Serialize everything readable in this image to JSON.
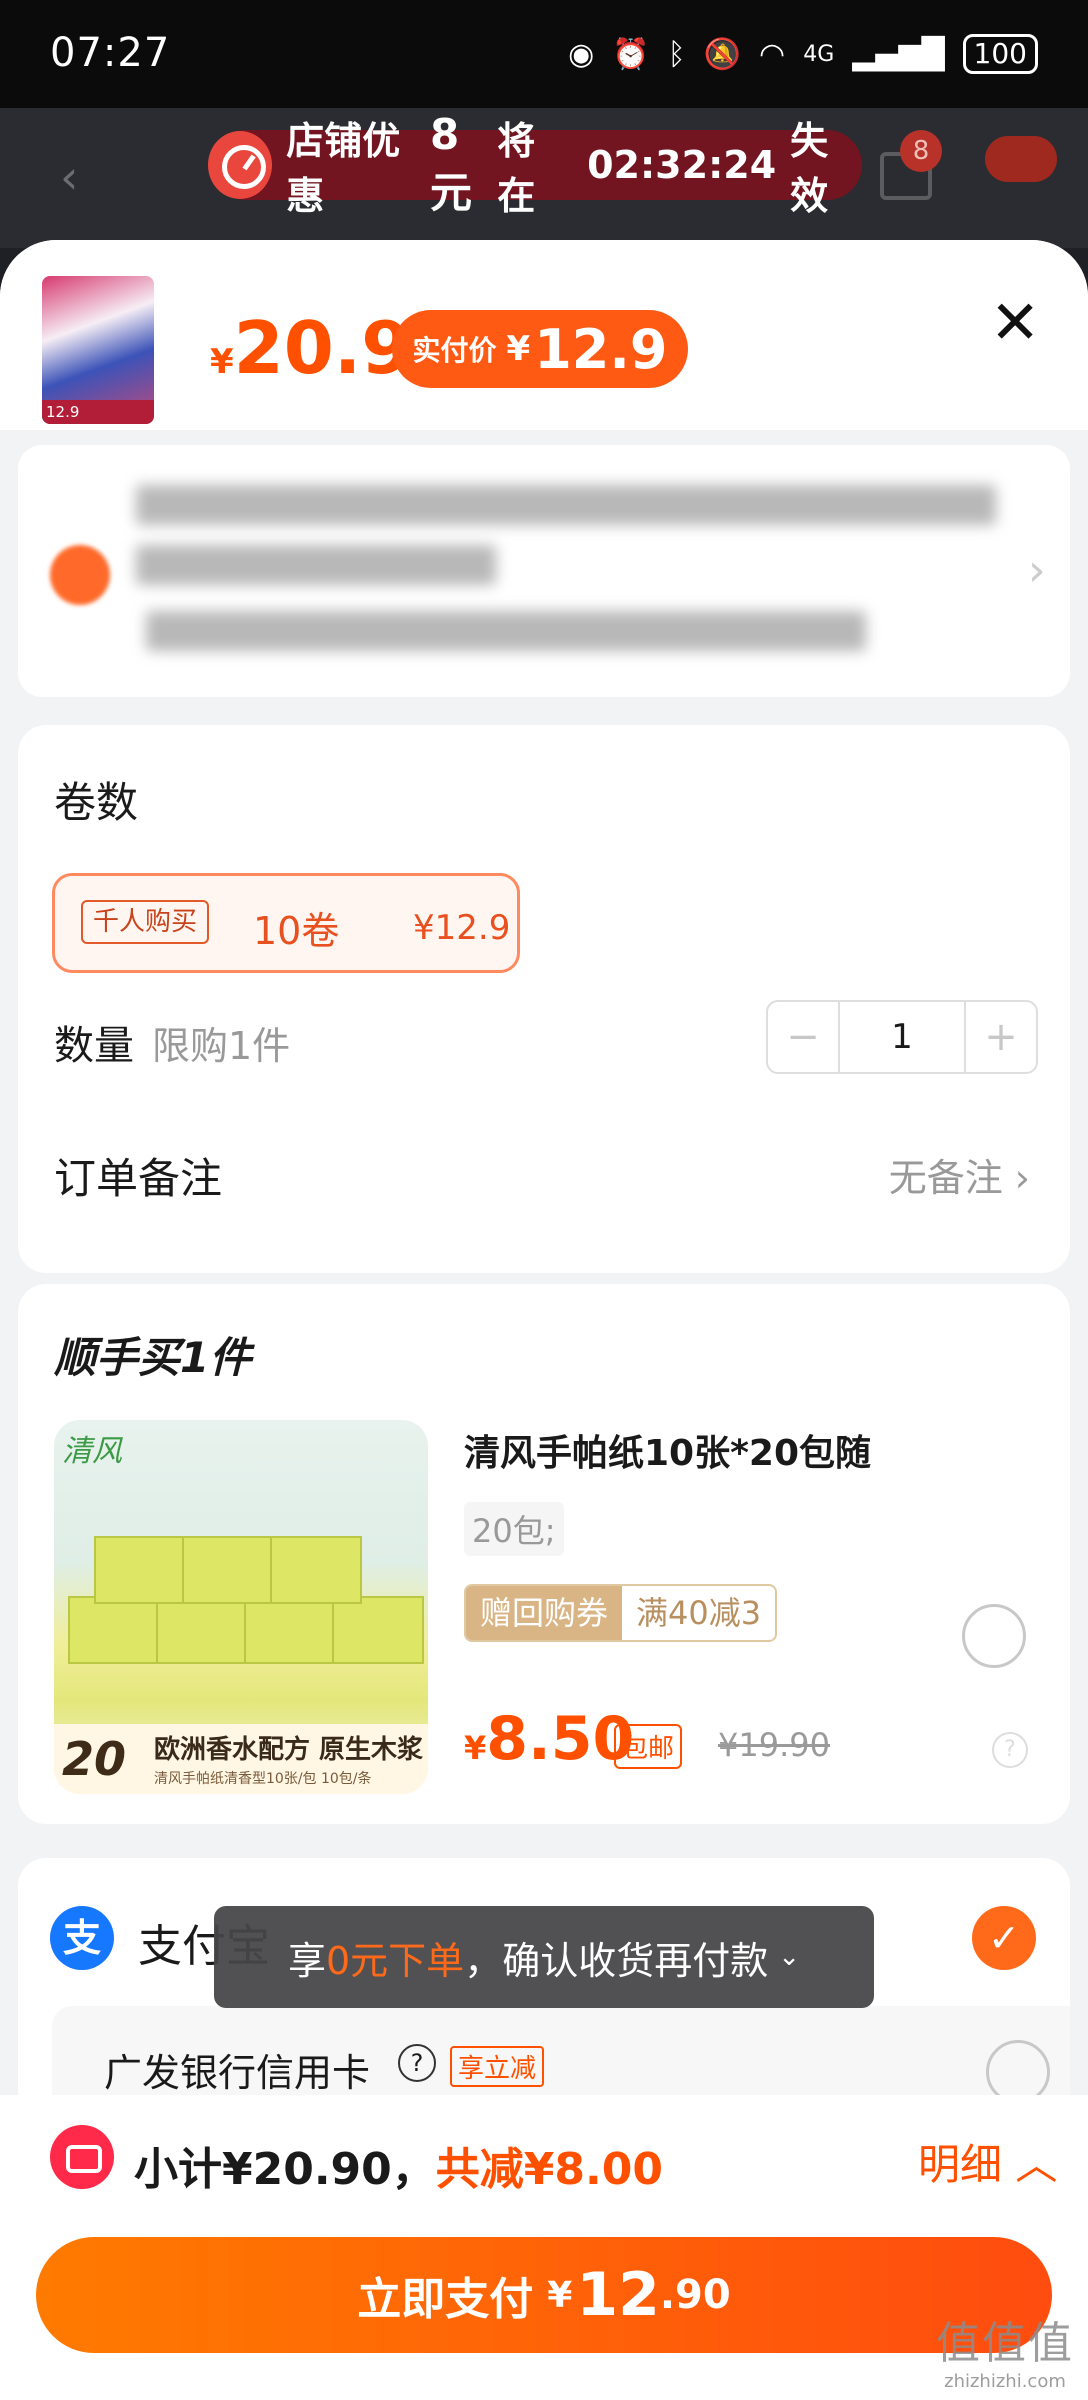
{
  "status_bar": {
    "time": "07:27",
    "network": "4G",
    "battery": "100"
  },
  "background_header": {
    "cart_badge": "8"
  },
  "promo": {
    "prefix": "店铺优惠",
    "amount": "8元",
    "middle": "将在",
    "countdown": "02:32:24",
    "suffix": "失效"
  },
  "product": {
    "thumb_label": "12.9",
    "currency": "¥",
    "price": "20.9",
    "paid_label": "实付价",
    "paid_currency": "¥",
    "paid_price": "12.9"
  },
  "options": {
    "roll_title": "卷数",
    "sku_tag": "千人购买",
    "sku_name": "10卷",
    "sku_price": "¥12.9",
    "qty_label": "数量",
    "qty_limit": "限购1件",
    "qty_value": "1",
    "qty_minus": "−",
    "qty_plus": "+",
    "note_label": "订单备注",
    "note_value": "无备注"
  },
  "addon": {
    "title": "顺手买1件",
    "name": "清风手帕纸10张*20包随",
    "spec": "20包;",
    "coupon_left": "赠回购券",
    "coupon_right": "满40减3",
    "currency": "¥",
    "price": "8.50",
    "free_shipping": "包邮",
    "original_price": "¥19.90",
    "img_logo": "清风",
    "img_count": "20",
    "img_text": "欧洲香水配方 原生木浆",
    "img_sub": "清风手帕纸清香型10张/包 10包/条"
  },
  "payment": {
    "alipay_label": "支付宝",
    "bank_label": "广发银行信用卡",
    "bank_tag": "享立减"
  },
  "toast": {
    "prefix": "享",
    "highlight": "0元下单",
    "suffix": "，确认收货再付款"
  },
  "summary": {
    "subtotal": "小计¥20.90，",
    "discount": "共减¥8.00",
    "detail_label": "明细"
  },
  "pay_button": {
    "label": "立即支付",
    "currency": "¥",
    "amount_int": "12",
    "amount_dec": ".90"
  },
  "watermark": {
    "main": "值值值",
    "sub": "zhizhizhi.com"
  },
  "colors": {
    "accent": "#ff5000",
    "alipay": "#1677ff"
  }
}
